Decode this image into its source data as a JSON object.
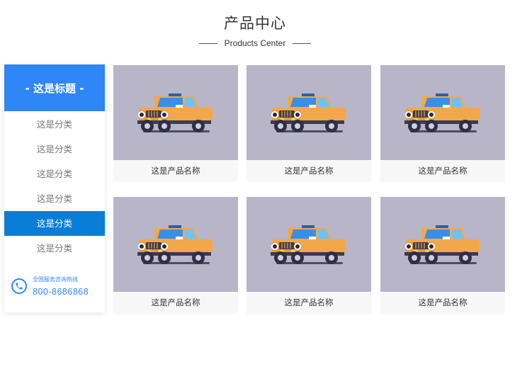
{
  "header": {
    "title": "产品中心",
    "subtitle": "Products Center"
  },
  "sidebar": {
    "title": "-  这是标题  -",
    "items": [
      {
        "label": "这是分类",
        "active": false
      },
      {
        "label": "这是分类",
        "active": false
      },
      {
        "label": "这是分类",
        "active": false
      },
      {
        "label": "这是分类",
        "active": false
      },
      {
        "label": "这是分类",
        "active": true
      },
      {
        "label": "这是分类",
        "active": false
      }
    ],
    "hotline_label": "全国服务咨询热线",
    "hotline_number": "800-8686868"
  },
  "products": [
    {
      "name": "这是产品名称",
      "image": "car-illustration"
    },
    {
      "name": "这是产品名称",
      "image": "car-illustration"
    },
    {
      "name": "这是产品名称",
      "image": "car-illustration"
    },
    {
      "name": "这是产品名称",
      "image": "car-illustration"
    },
    {
      "name": "这是产品名称",
      "image": "car-illustration"
    },
    {
      "name": "这是产品名称",
      "image": "car-illustration"
    }
  ],
  "colors": {
    "accent": "#2f86f6",
    "active_item": "#0a7ed6",
    "image_bg": "#b8b5c8",
    "car_body": "#f2a84a",
    "car_window": "#3a8ee6"
  }
}
